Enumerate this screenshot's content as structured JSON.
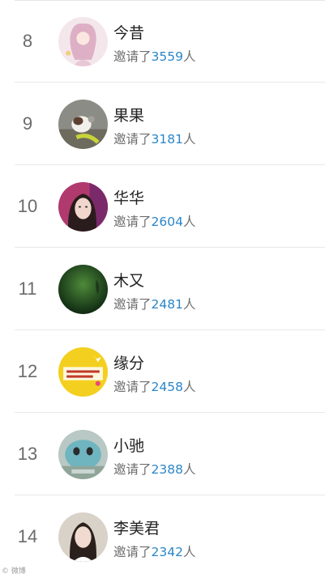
{
  "invite_prefix": "邀请了",
  "invite_suffix": "人",
  "rows": [
    {
      "rank": "8",
      "name": "今昔",
      "count": "3559",
      "avatar": "avatar-pink-illustration"
    },
    {
      "rank": "9",
      "name": "果果",
      "count": "3181",
      "avatar": "avatar-photo-pet"
    },
    {
      "rank": "10",
      "name": "华华",
      "count": "2604",
      "avatar": "avatar-photo-woman"
    },
    {
      "rank": "11",
      "name": "木又",
      "count": "2481",
      "avatar": "avatar-dark-green-photo"
    },
    {
      "rank": "12",
      "name": "缘分",
      "count": "2458",
      "avatar": "avatar-yellow-badge"
    },
    {
      "rank": "13",
      "name": "小驰",
      "count": "2388",
      "avatar": "avatar-teal-cartoon"
    },
    {
      "rank": "14",
      "name": "李美君",
      "count": "2342",
      "avatar": "avatar-photo-woman-2"
    }
  ],
  "colors": {
    "accent": "#2a86c9",
    "rank": "#6b6b6b",
    "divider": "#e8e8e8"
  },
  "watermark": "© 微博"
}
